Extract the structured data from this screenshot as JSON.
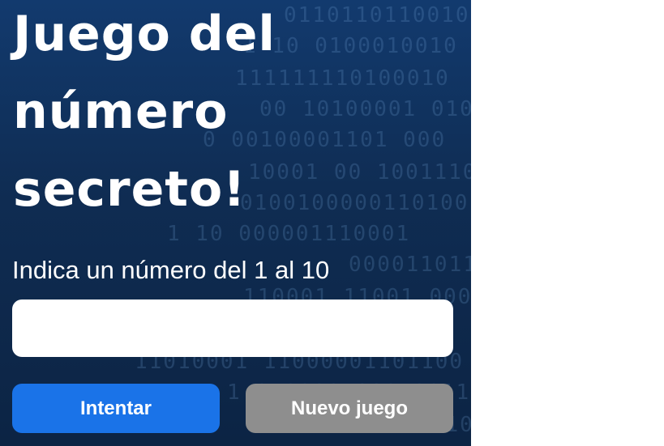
{
  "game": {
    "title_lines": [
      "Juego del",
      "número",
      "secreto!"
    ],
    "prompt": "Indica un número del 1 al 10",
    "input_value": "",
    "try_button": "Intentar",
    "new_game_button": "Nuevo juego"
  },
  "theme": {
    "background": "#0f2c52",
    "primary_button": "#1a73e8",
    "secondary_button": "#8e8e8e",
    "text": "#ffffff"
  }
}
